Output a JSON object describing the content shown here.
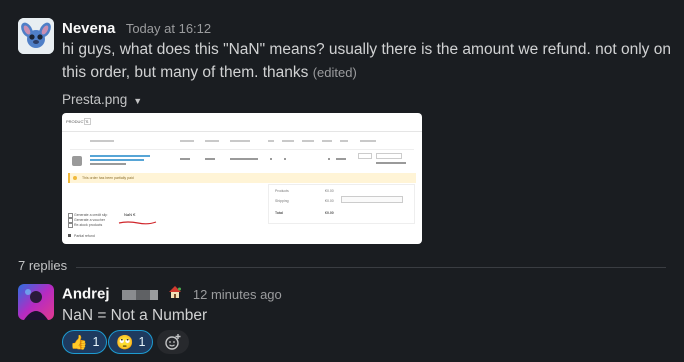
{
  "message1": {
    "author": "Nevena",
    "timestamp": "Today at 16:12",
    "text": "hi guys, what does this \"NaN\" means? usually there is the amount we refund. not only on this order, but many of them. thanks",
    "edited": "(edited)",
    "attachment": {
      "filename": "Presta.png",
      "preview": {
        "tab_label": "PRODUCTS",
        "alert_text": "This order has been partially paid",
        "nan_value": "NaN €",
        "checkboxes": [
          "Generate a credit slip",
          "Generate a voucher",
          "Re-stock products"
        ],
        "action": "Partial refund",
        "summary_rows": [
          {
            "label": "Products",
            "value": "€0.00"
          },
          {
            "label": "Shipping",
            "value": "€0.00"
          },
          {
            "label": "Total",
            "value": "€0.00"
          }
        ]
      }
    }
  },
  "thread": {
    "replies_label": "7 replies"
  },
  "message2": {
    "author": "Andrej",
    "timestamp": "12 minutes ago",
    "text": "NaN = Not a Number",
    "reactions": [
      {
        "emoji": "👍",
        "count": "1",
        "icon": "thumbs-up-icon"
      },
      {
        "emoji": "🙄",
        "count": "1",
        "icon": "custom-emoji-icon"
      }
    ]
  },
  "colors": {
    "background": "#1a1d21",
    "reaction_bg": "#1e3a5f",
    "reaction_border": "#1d9bd1",
    "nan_underline": "#d0262b"
  }
}
